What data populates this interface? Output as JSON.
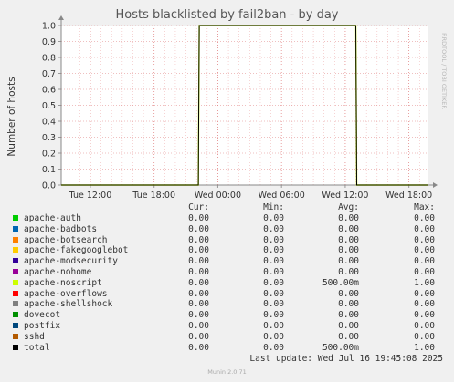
{
  "title": "Hosts blacklisted by fail2ban - by day",
  "ylabel": "Number of hosts",
  "watermark": "RRDTOOL / TOBI OETIKER",
  "chart_data": {
    "type": "line",
    "title": "Hosts blacklisted by fail2ban - by day",
    "ylabel": "Number of hosts",
    "xlabel": "",
    "ylim": [
      0,
      1
    ],
    "yticks": [
      "0.0",
      "0.1",
      "0.2",
      "0.3",
      "0.4",
      "0.5",
      "0.6",
      "0.7",
      "0.8",
      "0.9",
      "1.0"
    ],
    "xticks": [
      "Tue 12:00",
      "Tue 18:00",
      "Wed 00:00",
      "Wed 06:00",
      "Wed 12:00",
      "Wed 18:00"
    ],
    "xrange": [
      "Tue 09:15",
      "Wed 19:45"
    ],
    "grid": true,
    "series": [
      {
        "name": "apache-noscript",
        "color": "#ccff00",
        "x": [
          "Tue 09:15",
          "Tue 22:10",
          "Tue 22:15",
          "Wed 13:00",
          "Wed 13:05",
          "Wed 19:45"
        ],
        "values": [
          0,
          0,
          1,
          1,
          0,
          0
        ]
      },
      {
        "name": "total",
        "color": "#000000",
        "x": [
          "Tue 09:15",
          "Tue 22:10",
          "Tue 22:15",
          "Wed 13:00",
          "Wed 13:05",
          "Wed 19:45"
        ],
        "values": [
          0,
          0,
          1,
          1,
          0,
          0
        ]
      }
    ]
  },
  "legend": {
    "headers": {
      "cur": "Cur:",
      "min": "Min:",
      "avg": "Avg:",
      "max": "Max:"
    },
    "rows": [
      {
        "name": "apache-auth",
        "color": "#00cc00",
        "cur": "0.00",
        "min": "0.00",
        "avg": "0.00",
        "max": "0.00"
      },
      {
        "name": "apache-badbots",
        "color": "#0066b3",
        "cur": "0.00",
        "min": "0.00",
        "avg": "0.00",
        "max": "0.00"
      },
      {
        "name": "apache-botsearch",
        "color": "#ff8000",
        "cur": "0.00",
        "min": "0.00",
        "avg": "0.00",
        "max": "0.00"
      },
      {
        "name": "apache-fakegooglebot",
        "color": "#ffcc00",
        "cur": "0.00",
        "min": "0.00",
        "avg": "0.00",
        "max": "0.00"
      },
      {
        "name": "apache-modsecurity",
        "color": "#330099",
        "cur": "0.00",
        "min": "0.00",
        "avg": "0.00",
        "max": "0.00"
      },
      {
        "name": "apache-nohome",
        "color": "#990099",
        "cur": "0.00",
        "min": "0.00",
        "avg": "0.00",
        "max": "0.00"
      },
      {
        "name": "apache-noscript",
        "color": "#ccff00",
        "cur": "0.00",
        "min": "0.00",
        "avg": "500.00m",
        "max": "1.00"
      },
      {
        "name": "apache-overflows",
        "color": "#ff0000",
        "cur": "0.00",
        "min": "0.00",
        "avg": "0.00",
        "max": "0.00"
      },
      {
        "name": "apache-shellshock",
        "color": "#808080",
        "cur": "0.00",
        "min": "0.00",
        "avg": "0.00",
        "max": "0.00"
      },
      {
        "name": "dovecot",
        "color": "#008f00",
        "cur": "0.00",
        "min": "0.00",
        "avg": "0.00",
        "max": "0.00"
      },
      {
        "name": "postfix",
        "color": "#00487d",
        "cur": "0.00",
        "min": "0.00",
        "avg": "0.00",
        "max": "0.00"
      },
      {
        "name": "sshd",
        "color": "#b35a00",
        "cur": "0.00",
        "min": "0.00",
        "avg": "0.00",
        "max": "0.00"
      },
      {
        "name": "total",
        "color": "#000000",
        "cur": "0.00",
        "min": "0.00",
        "avg": "500.00m",
        "max": "1.00"
      }
    ]
  },
  "last_update": "Last update: Wed Jul 16 19:45:08 2025",
  "version": "Munin 2.0.71"
}
